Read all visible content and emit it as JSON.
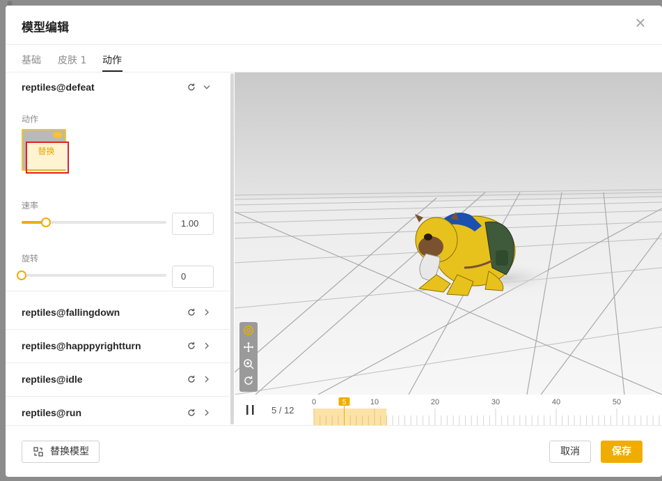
{
  "dialog": {
    "title": "模型编辑",
    "close_symbol": "✕"
  },
  "tabs": [
    {
      "label": "基础",
      "active": false
    },
    {
      "label": "皮肤 1",
      "active": false
    },
    {
      "label": "动作",
      "active": true
    }
  ],
  "expanded_animation": {
    "name": "reptiles@defeat",
    "action_label": "动作",
    "replace_label": "替换",
    "speed_label": "速率",
    "speed_value": "1.00",
    "speed_fraction": 0.17,
    "rotation_label": "旋转",
    "rotation_value": "0",
    "rotation_fraction": 0
  },
  "animations": [
    {
      "name": "reptiles@fallingdown"
    },
    {
      "name": "reptiles@happpyrightturn"
    },
    {
      "name": "reptiles@idle"
    },
    {
      "name": "reptiles@run"
    }
  ],
  "viewport_tools": [
    "at-icon",
    "move-icon",
    "zoom-in-icon",
    "rotate-icon"
  ],
  "timeline": {
    "current_frame": 5,
    "total_frames": 12,
    "counter_text": "5 / 12",
    "ruler_labels": [
      "0",
      "10",
      "20",
      "30",
      "40",
      "50"
    ],
    "ruler_values": [
      0,
      10,
      20,
      30,
      40,
      50
    ],
    "marker_label": "5"
  },
  "footer": {
    "replace_model_label": "替换模型",
    "cancel_label": "取消",
    "save_label": "保存"
  },
  "colors": {
    "accent": "#f0ad00",
    "highlight": "#e0201c",
    "model_yellow": "#e8c21c",
    "model_blue": "#1b4fb0",
    "model_green": "#3f5a3b"
  }
}
